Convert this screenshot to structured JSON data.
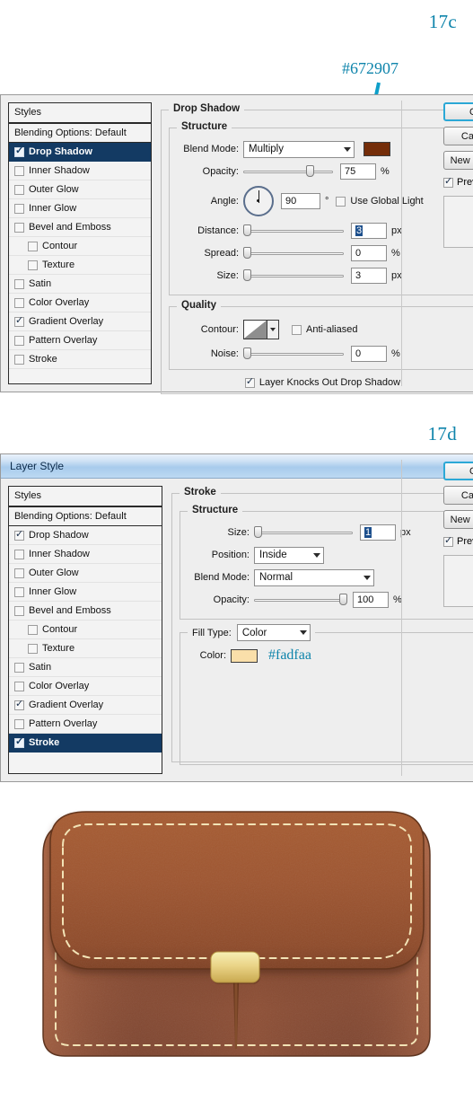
{
  "figures": {
    "panel1_label": "17c",
    "panel2_label": "17d"
  },
  "annotations": {
    "dropshadow_color_hex": "#672907",
    "stroke_color_hex": "#fadfaa",
    "accent_color": "#0e84ab"
  },
  "styles_list": {
    "header": "Styles",
    "blending_options": "Blending Options: Default",
    "items": [
      {
        "label": "Drop Shadow",
        "checked": true,
        "indent": false
      },
      {
        "label": "Inner Shadow",
        "checked": false,
        "indent": false
      },
      {
        "label": "Outer Glow",
        "checked": false,
        "indent": false
      },
      {
        "label": "Inner Glow",
        "checked": false,
        "indent": false
      },
      {
        "label": "Bevel and Emboss",
        "checked": false,
        "indent": false
      },
      {
        "label": "Contour",
        "checked": false,
        "indent": true
      },
      {
        "label": "Texture",
        "checked": false,
        "indent": true
      },
      {
        "label": "Satin",
        "checked": false,
        "indent": false
      },
      {
        "label": "Color Overlay",
        "checked": false,
        "indent": false
      },
      {
        "label": "Gradient Overlay",
        "checked": true,
        "indent": false
      },
      {
        "label": "Pattern Overlay",
        "checked": false,
        "indent": false
      },
      {
        "label": "Stroke",
        "checked": false,
        "indent": false
      }
    ]
  },
  "panel1": {
    "selected_style": "Drop Shadow",
    "section_title": "Drop Shadow",
    "structure_legend": "Structure",
    "quality_legend": "Quality",
    "blend_mode_label": "Blend Mode:",
    "blend_mode_value": "Multiply",
    "color_swatch": "#672907",
    "opacity_label": "Opacity:",
    "opacity_value": "75",
    "opacity_unit": "%",
    "angle_label": "Angle:",
    "angle_value": "90",
    "angle_unit": "°",
    "use_global_light": "Use Global Light",
    "use_global_light_checked": false,
    "distance_label": "Distance:",
    "distance_value": "3",
    "distance_unit": "px",
    "spread_label": "Spread:",
    "spread_value": "0",
    "spread_unit": "%",
    "size_label": "Size:",
    "size_value": "3",
    "size_unit": "px",
    "contour_label": "Contour:",
    "anti_aliased": "Anti-aliased",
    "anti_aliased_checked": false,
    "noise_label": "Noise:",
    "noise_value": "0",
    "noise_unit": "%",
    "layer_knocks_out": "Layer Knocks Out Drop Shadow",
    "layer_knocks_out_checked": true,
    "stroke_item_checked": false,
    "dropshadow_item_checked": true
  },
  "panel2": {
    "window_title": "Layer Style",
    "selected_style": "Stroke",
    "section_title": "Stroke",
    "structure_legend": "Structure",
    "size_label": "Size:",
    "size_value": "1",
    "size_unit": "px",
    "position_label": "Position:",
    "position_value": "Inside",
    "blend_mode_label": "Blend Mode:",
    "blend_mode_value": "Normal",
    "opacity_label": "Opacity:",
    "opacity_value": "100",
    "opacity_unit": "%",
    "fill_type_label": "Fill Type:",
    "fill_type_value": "Color",
    "color_label": "Color:",
    "color_swatch": "#fadfaa",
    "color_hex_text": "#fadfaa",
    "stroke_item_checked": true,
    "dropshadow_item_checked": true
  },
  "buttons": {
    "ok": "OK",
    "cancel": "Cancel",
    "new_style": "New Style...",
    "preview": "Preview"
  },
  "wallet": {
    "description": "Brown leather wallet icon with cream stitching and gold clasp",
    "body_color": "#a0522d",
    "flap_color": "#a85c32",
    "stitch_color": "#f0e0b0",
    "clasp_color": "#e8d27a"
  }
}
